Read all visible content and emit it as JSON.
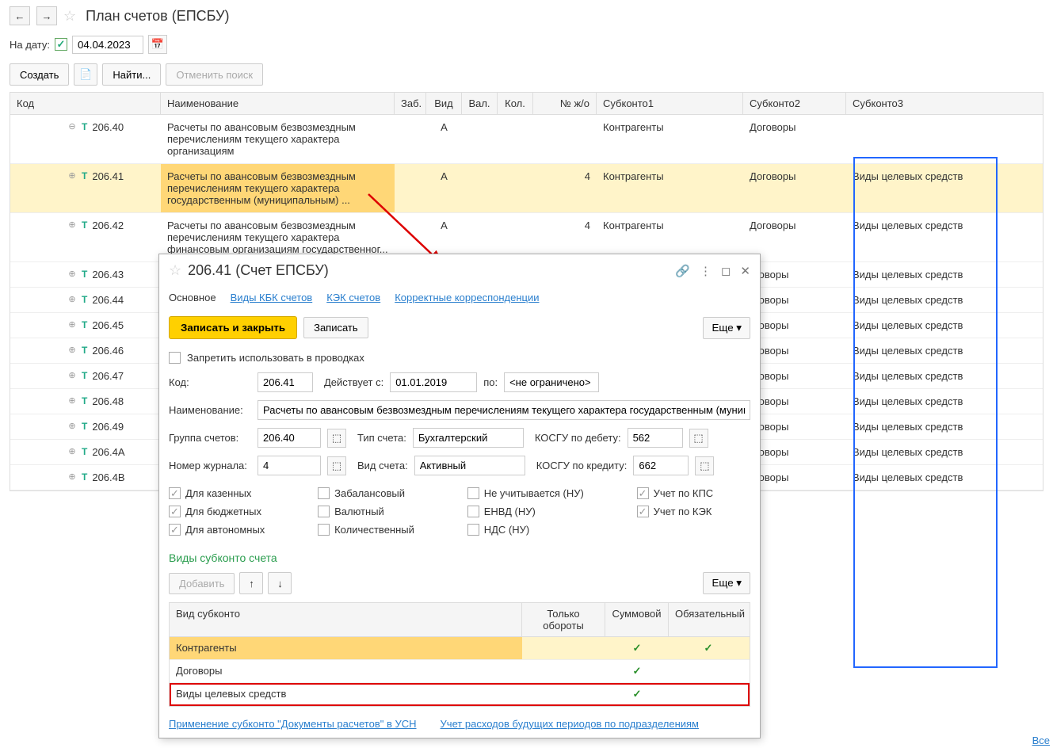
{
  "header": {
    "title": "План счетов (ЕПСБУ)"
  },
  "date_filter": {
    "label": "На дату:",
    "value": "04.04.2023"
  },
  "toolbar": {
    "create": "Создать",
    "find": "Найти...",
    "cancel_search": "Отменить поиск"
  },
  "columns": {
    "code": "Код",
    "name": "Наименование",
    "zab": "Заб.",
    "vid": "Вид",
    "val": "Вал.",
    "kol": "Кол.",
    "nzh": "№ ж/о",
    "sub1": "Субконто1",
    "sub2": "Субконто2",
    "sub3": "Субконто3"
  },
  "rows": [
    {
      "exp": "⊖",
      "code": "206.40",
      "name": "Расчеты по авансовым безвозмездным перечислениям текущего характера организациям",
      "vid": "А",
      "nzh": "",
      "sub1": "Контрагенты",
      "sub2": "Договоры",
      "sub3": ""
    },
    {
      "exp": "⊕",
      "code": "206.41",
      "name": "Расчеты по авансовым безвозмездным перечислениям текущего характера государственным (муниципальным) ...",
      "vid": "А",
      "nzh": "4",
      "sub1": "Контрагенты",
      "sub2": "Договоры",
      "sub3": "Виды целевых средств",
      "sel": true
    },
    {
      "exp": "⊕",
      "code": "206.42",
      "name": "Расчеты по авансовым безвозмездным перечислениям текущего характера финансовым организациям государственног...",
      "vid": "А",
      "nzh": "4",
      "sub1": "Контрагенты",
      "sub2": "Договоры",
      "sub3": "Виды целевых средств"
    },
    {
      "exp": "⊕",
      "code": "206.43",
      "name": "",
      "vid": "",
      "nzh": "",
      "sub1": "",
      "sub2": "оговоры",
      "sub3": "Виды целевых средств"
    },
    {
      "exp": "⊕",
      "code": "206.44",
      "name": "",
      "vid": "",
      "nzh": "",
      "sub1": "",
      "sub2": "оговоры",
      "sub3": "Виды целевых средств"
    },
    {
      "exp": "⊕",
      "code": "206.45",
      "name": "",
      "vid": "",
      "nzh": "",
      "sub1": "",
      "sub2": "оговоры",
      "sub3": "Виды целевых средств"
    },
    {
      "exp": "⊕",
      "code": "206.46",
      "name": "",
      "vid": "",
      "nzh": "",
      "sub1": "",
      "sub2": "оговоры",
      "sub3": "Виды целевых средств"
    },
    {
      "exp": "⊕",
      "code": "206.47",
      "name": "",
      "vid": "",
      "nzh": "",
      "sub1": "",
      "sub2": "оговоры",
      "sub3": "Виды целевых средств"
    },
    {
      "exp": "⊕",
      "code": "206.48",
      "name": "",
      "vid": "",
      "nzh": "",
      "sub1": "",
      "sub2": "оговоры",
      "sub3": "Виды целевых средств"
    },
    {
      "exp": "⊕",
      "code": "206.49",
      "name": "",
      "vid": "",
      "nzh": "",
      "sub1": "",
      "sub2": "оговоры",
      "sub3": "Виды целевых средств"
    },
    {
      "exp": "⊕",
      "code": "206.4А",
      "name": "",
      "vid": "",
      "nzh": "",
      "sub1": "",
      "sub2": "оговоры",
      "sub3": "Виды целевых средств"
    },
    {
      "exp": "⊕",
      "code": "206.4В",
      "name": "",
      "vid": "",
      "nzh": "",
      "sub1": "",
      "sub2": "оговоры",
      "sub3": "Виды целевых средств"
    }
  ],
  "dialog": {
    "title": "206.41 (Счет ЕПСБУ)",
    "tabs": {
      "main": "Основное",
      "kbk": "Виды КБК счетов",
      "kek": "КЭК счетов",
      "corr": "Корректные корреспонденции"
    },
    "buttons": {
      "save_close": "Записать и закрыть",
      "save": "Записать",
      "more": "Еще ▾"
    },
    "forbid": "Запретить использовать в проводках",
    "code_label": "Код:",
    "code": "206.41",
    "from_label": "Действует с:",
    "from": "01.01.2019",
    "to_label": "по:",
    "to": "<не ограничено>",
    "name_label": "Наименование:",
    "name": "Расчеты по авансовым безвозмездным перечислениям текущего характера государственным (муниципал",
    "group_label": "Группа счетов:",
    "group": "206.40",
    "acct_type_label": "Тип счета:",
    "acct_type": "Бухгалтерский",
    "kosgu_dt_label": "КОСГУ по дебету:",
    "kosgu_dt": "562",
    "journal_label": "Номер журнала:",
    "journal": "4",
    "vid_label": "Вид счета:",
    "vid": "Активный",
    "kosgu_kt_label": "КОСГУ по кредиту:",
    "kosgu_kt": "662",
    "flags": {
      "kazennyh": "Для казенных",
      "zabalans": "Забалансовый",
      "ne_nu": "Не учитывается (НУ)",
      "kps": "Учет по КПС",
      "budget": "Для бюджетных",
      "valut": "Валютный",
      "envd": "ЕНВД (НУ)",
      "kek": "Учет по КЭК",
      "autonom": "Для автономных",
      "kolich": "Количественный",
      "nds": "НДС (НУ)"
    },
    "subkonto_title": "Виды субконто счета",
    "add": "Добавить",
    "sub_cols": {
      "type": "Вид субконто",
      "oboroty": "Только обороты",
      "sum": "Суммовой",
      "req": "Обязательный"
    },
    "sub_rows": [
      {
        "type": "Контрагенты",
        "sum": "✓",
        "req": "✓",
        "sel": true
      },
      {
        "type": "Договоры",
        "sum": "✓",
        "req": ""
      },
      {
        "type": "Виды целевых средств",
        "sum": "✓",
        "req": "",
        "hl": true
      }
    ],
    "link1": "Применение субконто \"Документы расчетов\" в УСН",
    "link2": "Учет расходов будущих периодов по подразделениям"
  },
  "all": "Все"
}
